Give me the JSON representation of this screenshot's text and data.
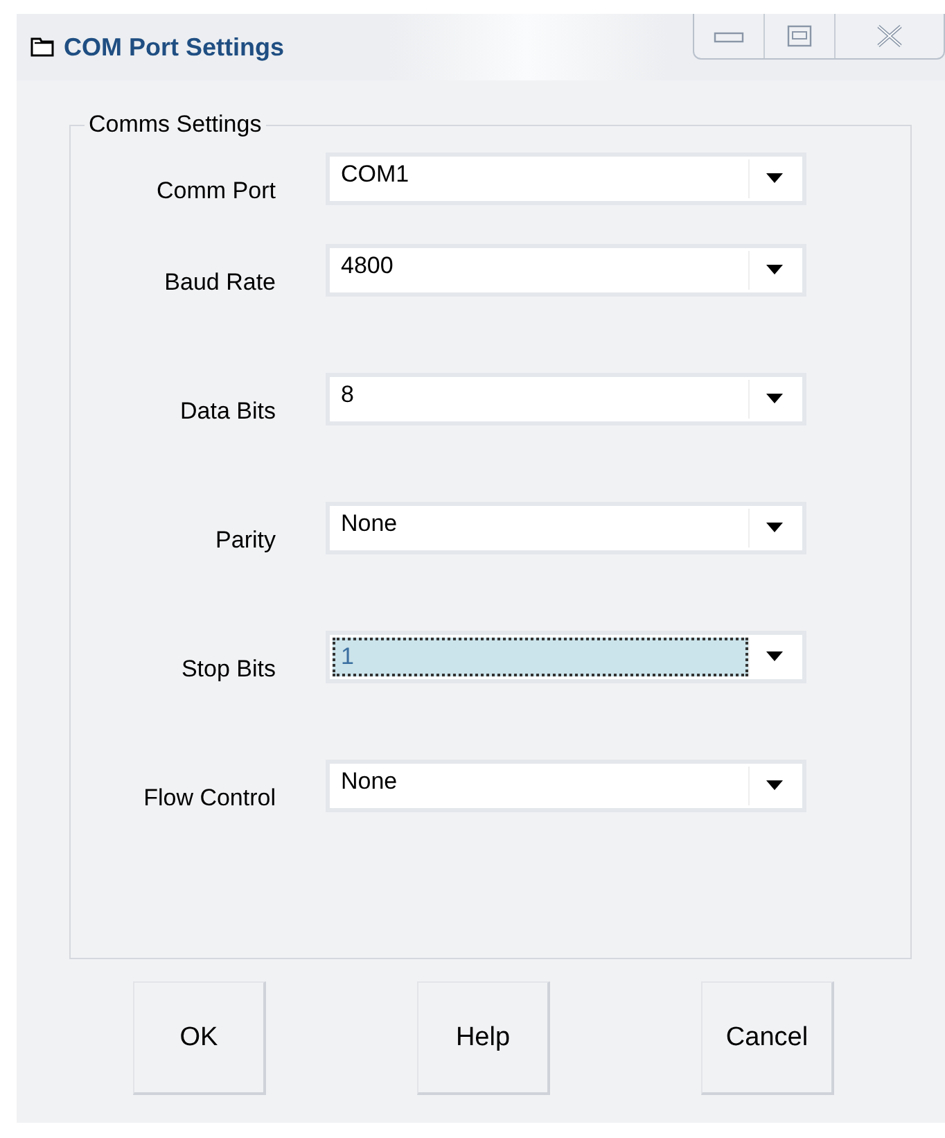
{
  "window": {
    "title": "COM Port Settings"
  },
  "group": {
    "title": "Comms Settings"
  },
  "fields": [
    {
      "label": "Comm Port",
      "value": "COM1",
      "focused": false
    },
    {
      "label": "Baud Rate",
      "value": "4800",
      "focused": false
    },
    {
      "label": "Data Bits",
      "value": "8",
      "focused": false
    },
    {
      "label": "Parity",
      "value": "None",
      "focused": false
    },
    {
      "label": "Stop Bits",
      "value": "1",
      "focused": true
    },
    {
      "label": "Flow Control",
      "value": "None",
      "focused": false
    }
  ],
  "buttons": [
    "OK",
    "Help",
    "Cancel"
  ]
}
